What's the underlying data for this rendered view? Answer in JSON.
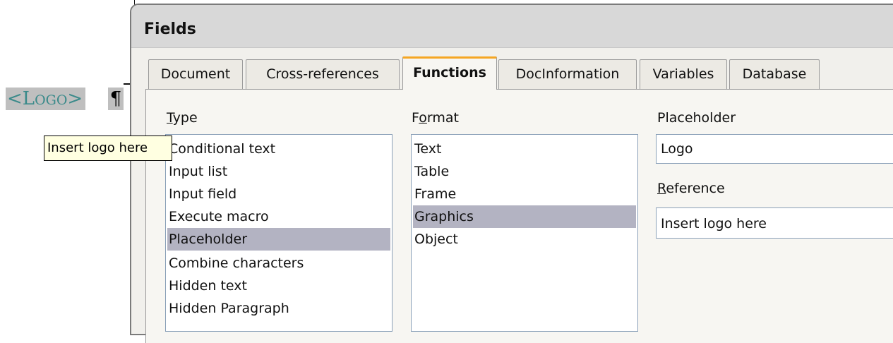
{
  "document": {
    "field_open": "<",
    "field_cap": "L",
    "field_small": "OGO",
    "field_close": ">",
    "pilcrow": "¶",
    "tooltip": "Insert logo here"
  },
  "dialog": {
    "title": "Fields",
    "tabs": [
      {
        "label": "Document"
      },
      {
        "label": "Cross-references"
      },
      {
        "label": "Functions"
      },
      {
        "label": "DocInformation"
      },
      {
        "label": "Variables"
      },
      {
        "label": "Database"
      }
    ],
    "active_tab": "Functions",
    "type": {
      "label_prefix": "",
      "label_mnemonic": "T",
      "label_rest": "ype",
      "items": [
        "Conditional text",
        "Input list",
        "Input field",
        "Execute macro",
        "Placeholder",
        "Combine characters",
        "Hidden text",
        "Hidden Paragraph"
      ],
      "selected": "Placeholder"
    },
    "format": {
      "label_prefix": "F",
      "label_mnemonic": "o",
      "label_rest": "rmat",
      "items": [
        "Text",
        "Table",
        "Frame",
        "Graphics",
        "Object"
      ],
      "selected": "Graphics"
    },
    "placeholder": {
      "label": "Placeholder",
      "value": "Logo"
    },
    "reference": {
      "label_mnemonic": "R",
      "label_rest": "eference",
      "value": "Insert logo here"
    }
  }
}
